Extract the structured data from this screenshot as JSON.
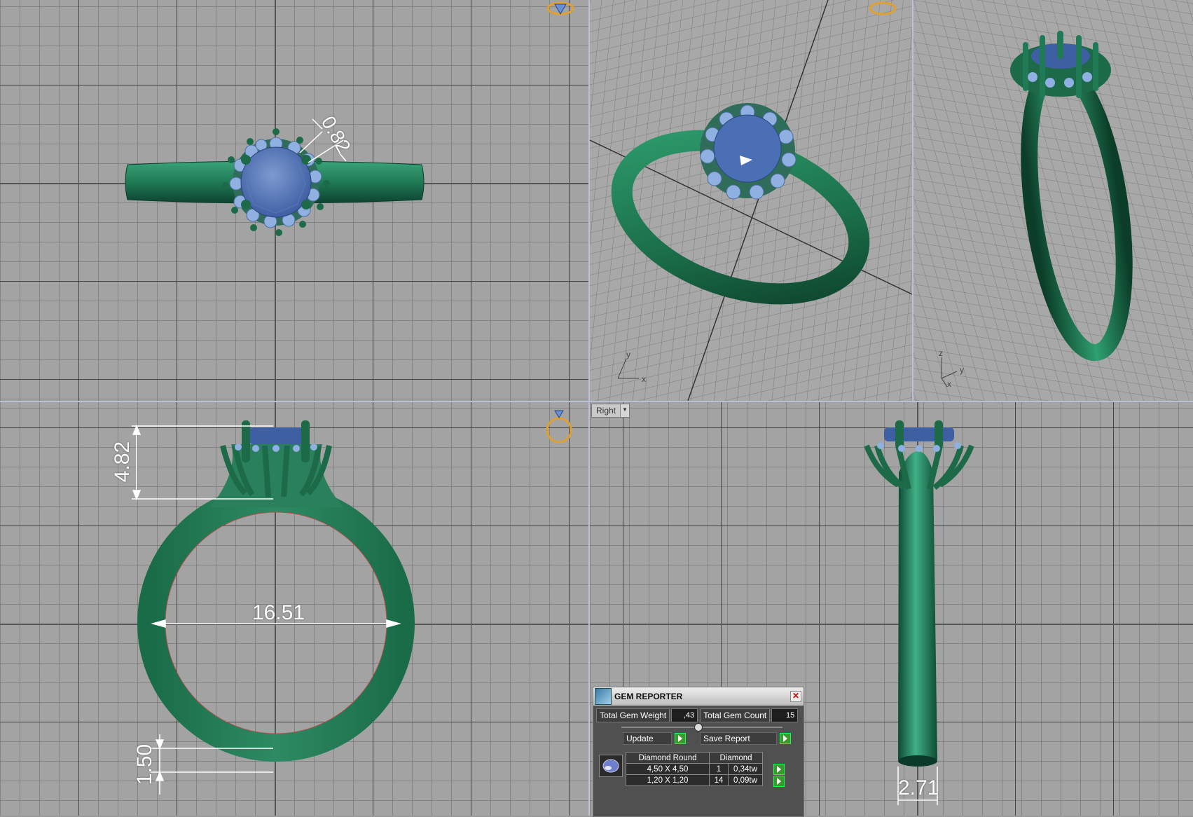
{
  "viewports": {
    "right_view_label": "Right"
  },
  "dimensions": {
    "prong_width": "0.82",
    "head_height": "4.82",
    "inner_diameter": "16.51",
    "band_thickness": "1.50",
    "band_width": "2.71"
  },
  "axes": {
    "persp1": {
      "y": "y",
      "x": "x"
    },
    "persp2": {
      "z": "z",
      "y": "y",
      "x": "x"
    }
  },
  "gem_reporter": {
    "title": "GEM REPORTER",
    "total_weight_label": "Total Gem Weight",
    "total_weight_value": ",43",
    "total_count_label": "Total Gem Count",
    "total_count_value": "15",
    "update_label": "Update",
    "save_report_label": "Save Report",
    "table": {
      "headers": [
        "Diamond Round",
        "Diamond"
      ],
      "rows": [
        {
          "size": "4,50 X 4,50",
          "count": "1",
          "weight": "0,34tw"
        },
        {
          "size": "1,20 X 1,20",
          "count": "14",
          "weight": "0,09tw"
        }
      ]
    }
  },
  "colors": {
    "metal": "#1f7a55",
    "gem": "#4a6fb5",
    "accent_gem": "#8fb0e0",
    "viewport_divider": "#b9c0d4"
  }
}
